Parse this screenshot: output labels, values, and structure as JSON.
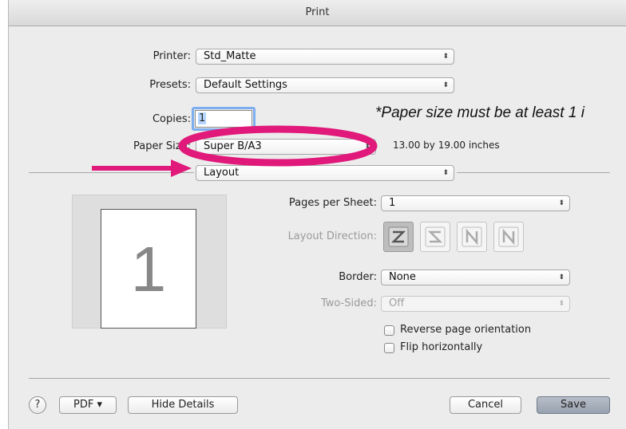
{
  "window": {
    "title": "Print"
  },
  "printer": {
    "label": "Printer:",
    "value": "Std_Matte"
  },
  "presets": {
    "label": "Presets:",
    "value": "Default Settings"
  },
  "copies": {
    "label": "Copies:",
    "value": "1"
  },
  "paper_size": {
    "label": "Paper Size:",
    "value": "Super B/A3",
    "description": "13.00 by 19.00 inches"
  },
  "annotation": {
    "note": "*Paper size must be at least 1 i",
    "accent_color": "#e0197a"
  },
  "section": {
    "value": "Layout"
  },
  "preview": {
    "page_number": "1"
  },
  "pages_per_sheet": {
    "label": "Pages per Sheet:",
    "value": "1"
  },
  "layout_direction": {
    "label": "Layout Direction:",
    "icons": [
      "z-direction-icon",
      "reverse-z-direction-icon",
      "n-direction-icon",
      "reverse-n-direction-icon"
    ]
  },
  "border": {
    "label": "Border:",
    "value": "None"
  },
  "two_sided": {
    "label": "Two-Sided:",
    "value": "Off"
  },
  "options": {
    "reverse_label": "Reverse page orientation",
    "flip_label": "Flip horizontally"
  },
  "footer": {
    "help_label": "?",
    "pdf_label": "PDF ▾",
    "hide_details_label": "Hide Details",
    "cancel_label": "Cancel",
    "save_label": "Save"
  }
}
